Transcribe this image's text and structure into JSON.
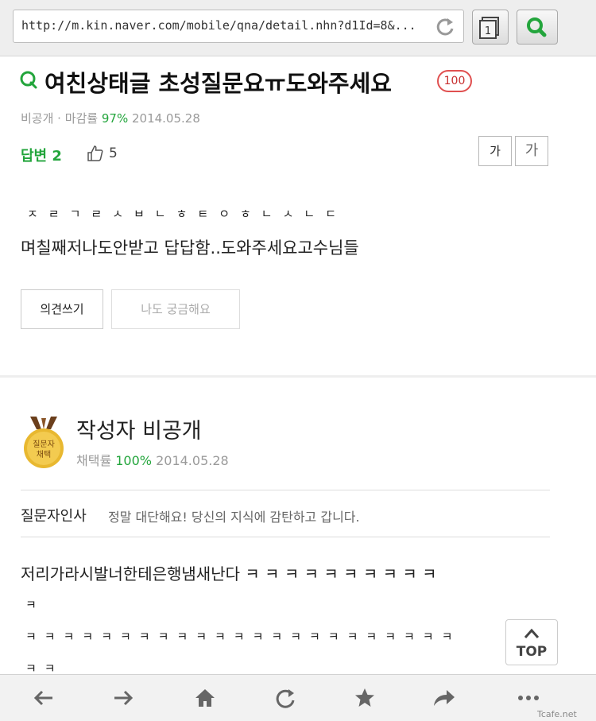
{
  "browser": {
    "url": "http://m.kin.naver.com/mobile/qna/detail.nhn?d1Id=8&..."
  },
  "question": {
    "title": "여친상태글 초성질문요ㅠ도와주세요",
    "reward_badge": "100",
    "meta_prefix": "비공개 · 마감률 ",
    "meta_rate": "97%",
    "meta_date": " 2014.05.28",
    "answers_label": "답변 2",
    "likes": "5",
    "font_small_label": "가",
    "font_large_label": "가",
    "chosung_line": "ㅈㄹㄱㄹㅅㅂㄴㅎㅌㅇㅎㄴㅅㄴㄷ",
    "body_text": "며칠째저나도안받고 답답함..도와주세요고수님들",
    "opinion_button": "의견쓰기",
    "curious_button": "나도 궁금해요"
  },
  "answer": {
    "medal_text": "질문자 채택",
    "author": "작성자 비공개",
    "adopt_label": "채택률 ",
    "adopt_rate": "100%",
    "date": " 2014.05.28",
    "greeting_label": "질문자인사",
    "greeting_text": "정말 대단해요! 당신의 지식에 감탄하고 갑니다.",
    "line1": "저리가라시발너한테은행냄새난다 ㅋ ㅋ ㅋ ㅋ ㅋ ㅋ ㅋ ㅋ ㅋ ㅋ",
    "line2": "ㅋ",
    "line3": "ㅋㅋㅋㅋㅋㅋㅋㅋㅋㅋㅋㅋㅋㅋㅋㅋㅋㅋㅋㅋㅋㅋㅋ",
    "line4": "ㅋㅋ"
  },
  "top_button": "TOP",
  "watermark": "Tcafe.net",
  "colors": {
    "accent_green": "#23a53c",
    "badge_red": "#e05050",
    "medal_gold": "#e8b830"
  },
  "icons": [
    "reload-icon",
    "tabs-icon",
    "search-icon",
    "question-q-icon",
    "thumbs-up-icon",
    "medal-icon",
    "back-arrow-icon",
    "forward-arrow-icon",
    "home-icon",
    "refresh-icon",
    "star-icon",
    "share-icon",
    "more-icon",
    "chevron-up-icon"
  ]
}
